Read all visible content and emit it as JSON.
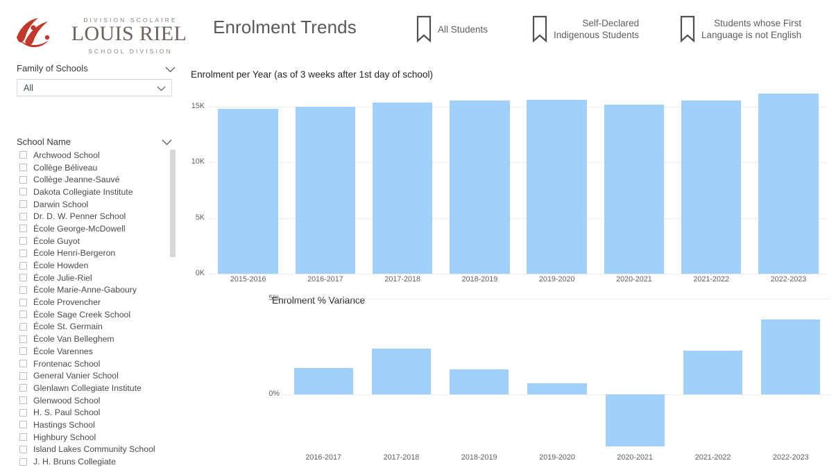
{
  "header": {
    "logo": {
      "top_text": "DIVISION SCOLAIRE",
      "main_text": "LOUIS RIEL",
      "bottom_text": "SCHOOL DIVISION",
      "mark_color": "#c0392b"
    },
    "title": "Enrolment Trends",
    "bookmarks": [
      {
        "icon": "bookmark-icon",
        "label": "All Students"
      },
      {
        "icon": "bookmark-icon",
        "label": "Self-Declared\nIndigenous Students"
      },
      {
        "icon": "bookmark-icon",
        "label": "Students whose First\nLanguage is not English"
      }
    ]
  },
  "sidebar": {
    "family_filter": {
      "label": "Family of Schools",
      "chevron": "chevron-down-icon",
      "selected": "All"
    },
    "school_filter": {
      "label": "School Name",
      "chevron": "chevron-down-icon",
      "items": [
        {
          "label": "Archwood School",
          "checked": false
        },
        {
          "label": "Collège Béliveau",
          "checked": false
        },
        {
          "label": "Collège Jeanne-Sauvé",
          "checked": false
        },
        {
          "label": "Dakota Collegiate Institute",
          "checked": false
        },
        {
          "label": "Darwin School",
          "checked": false
        },
        {
          "label": "Dr. D. W. Penner School",
          "checked": false
        },
        {
          "label": "École George-McDowell",
          "checked": false
        },
        {
          "label": "École Guyot",
          "checked": false
        },
        {
          "label": "École Henri-Bergeron",
          "checked": false
        },
        {
          "label": "École Howden",
          "checked": false
        },
        {
          "label": "École Julie-Riel",
          "checked": false
        },
        {
          "label": "École Marie-Anne-Gaboury",
          "checked": false
        },
        {
          "label": "École Provencher",
          "checked": false
        },
        {
          "label": "École Sage Creek School",
          "checked": false
        },
        {
          "label": "École St. Germain",
          "checked": false
        },
        {
          "label": "École Van Belleghem",
          "checked": false
        },
        {
          "label": "École Varennes",
          "checked": false
        },
        {
          "label": "Frontenac School",
          "checked": false
        },
        {
          "label": "General Vanier School",
          "checked": false
        },
        {
          "label": "Glenlawn Collegiate Institute",
          "checked": false
        },
        {
          "label": "Glenwood School",
          "checked": false
        },
        {
          "label": "H. S. Paul School",
          "checked": false
        },
        {
          "label": "Hastings School",
          "checked": false
        },
        {
          "label": "Highbury School",
          "checked": false
        },
        {
          "label": "Island Lakes Community School",
          "checked": false
        },
        {
          "label": "J. H. Bruns Collegiate",
          "checked": false
        }
      ]
    }
  },
  "colors": {
    "bar_fill": "#a0d0fb",
    "grid": "#d9d9d9",
    "axis_text": "#605e5c",
    "title_text": "#252423"
  },
  "chart_data": [
    {
      "type": "bar",
      "id": "enrolment-per-year",
      "title": "Enrolment per Year (as of 3 weeks after 1st day of school)",
      "xlabel": "",
      "ylabel": "",
      "categories": [
        "2015-2016",
        "2016-2017",
        "2017-2018",
        "2018-2019",
        "2019-2020",
        "2020-2021",
        "2021-2022",
        "2022-2023"
      ],
      "values": [
        14810,
        15010,
        15370,
        15540,
        15630,
        15200,
        15545,
        16150
      ],
      "ylim": [
        0,
        16800
      ],
      "yticks": [
        0,
        5000,
        10000,
        15000
      ],
      "ytick_labels": [
        "0K",
        "5K",
        "10K",
        "15K"
      ],
      "grid": true,
      "legend": "none"
    },
    {
      "type": "bar",
      "id": "enrolment-percent-variance",
      "title": "Enrolment % Variance",
      "xlabel": "",
      "ylabel": "",
      "categories": [
        "2016-2017",
        "2017-2018",
        "2018-2019",
        "2019-2020",
        "2020-2021",
        "2021-2022",
        "2022-2023"
      ],
      "values": [
        1.4,
        2.4,
        1.3,
        0.6,
        -2.7,
        2.3,
        3.9
      ],
      "ylim": [
        -3.4,
        5.4
      ],
      "yticks": [
        0,
        5
      ],
      "ytick_labels": [
        "0%",
        "5%"
      ],
      "grid": true,
      "legend": "none"
    }
  ]
}
